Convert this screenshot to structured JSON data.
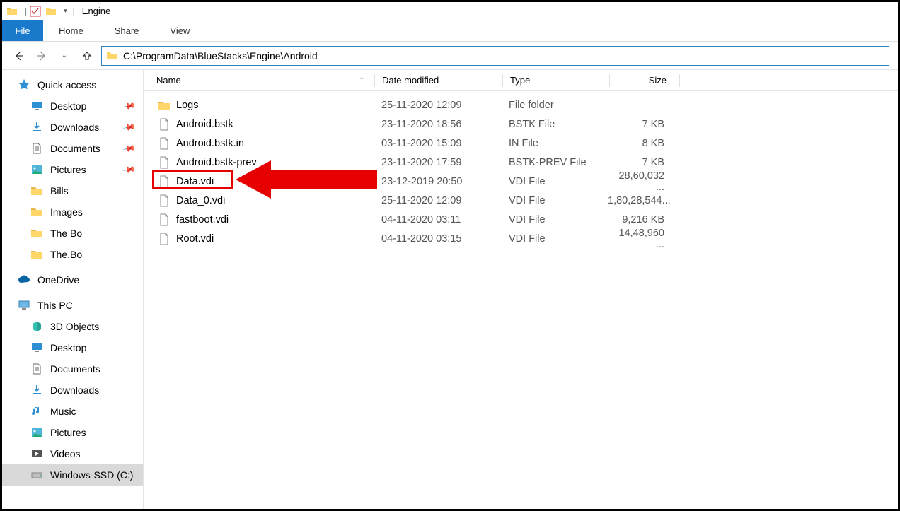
{
  "window": {
    "title": "Engine"
  },
  "ribbon": {
    "file": "File",
    "home": "Home",
    "share": "Share",
    "view": "View"
  },
  "address": {
    "path": "C:\\ProgramData\\BlueStacks\\Engine\\Android"
  },
  "columns": {
    "name": "Name",
    "date": "Date modified",
    "type": "Type",
    "size": "Size"
  },
  "sidebar": {
    "quick_access": "Quick access",
    "quick_items": [
      {
        "label": "Desktop",
        "icon": "desktop",
        "pinned": true
      },
      {
        "label": "Downloads",
        "icon": "downloads",
        "pinned": true
      },
      {
        "label": "Documents",
        "icon": "documents",
        "pinned": true
      },
      {
        "label": "Pictures",
        "icon": "pictures",
        "pinned": true
      },
      {
        "label": "Bills",
        "icon": "folder",
        "pinned": false
      },
      {
        "label": "Images",
        "icon": "folder",
        "pinned": false
      },
      {
        "label": "The Bo",
        "icon": "folder",
        "pinned": false
      },
      {
        "label": "The.Bo",
        "icon": "folder",
        "pinned": false
      }
    ],
    "onedrive": "OneDrive",
    "this_pc": "This PC",
    "pc_items": [
      {
        "label": "3D Objects",
        "icon": "objects3d"
      },
      {
        "label": "Desktop",
        "icon": "desktop"
      },
      {
        "label": "Documents",
        "icon": "documents"
      },
      {
        "label": "Downloads",
        "icon": "downloads"
      },
      {
        "label": "Music",
        "icon": "music"
      },
      {
        "label": "Pictures",
        "icon": "pictures"
      },
      {
        "label": "Videos",
        "icon": "videos"
      },
      {
        "label": "Windows-SSD (C:)",
        "icon": "drive",
        "selected": true
      }
    ]
  },
  "files": [
    {
      "name": "Logs",
      "date": "25-11-2020 12:09",
      "type": "File folder",
      "size": "",
      "icon": "folder"
    },
    {
      "name": "Android.bstk",
      "date": "23-11-2020 18:56",
      "type": "BSTK File",
      "size": "7 KB",
      "icon": "file"
    },
    {
      "name": "Android.bstk.in",
      "date": "03-11-2020 15:09",
      "type": "IN File",
      "size": "8 KB",
      "icon": "file"
    },
    {
      "name": "Android.bstk-prev",
      "date": "23-11-2020 17:59",
      "type": "BSTK-PREV File",
      "size": "7 KB",
      "icon": "file"
    },
    {
      "name": "Data.vdi",
      "date": "23-12-2019 20:50",
      "type": "VDI File",
      "size": "28,60,032 ...",
      "icon": "file",
      "highlighted": true
    },
    {
      "name": "Data_0.vdi",
      "date": "25-11-2020 12:09",
      "type": "VDI File",
      "size": "1,80,28,544...",
      "icon": "file"
    },
    {
      "name": "fastboot.vdi",
      "date": "04-11-2020 03:11",
      "type": "VDI File",
      "size": "9,216 KB",
      "icon": "file"
    },
    {
      "name": "Root.vdi",
      "date": "04-11-2020 03:15",
      "type": "VDI File",
      "size": "14,48,960 ...",
      "icon": "file"
    }
  ]
}
